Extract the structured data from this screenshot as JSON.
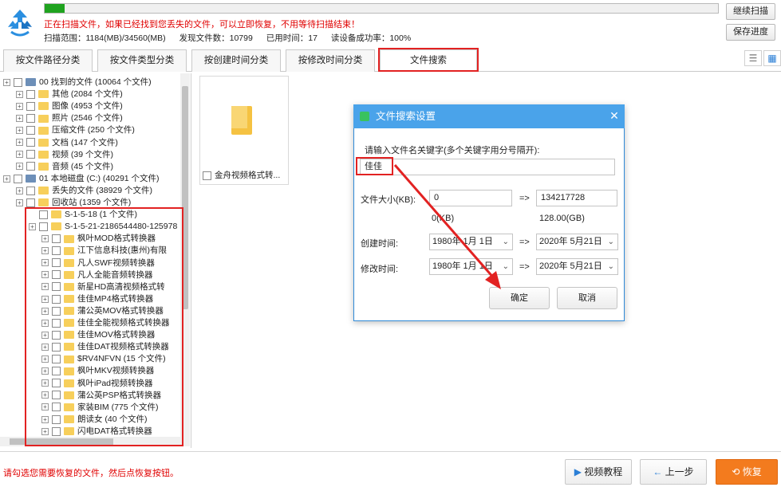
{
  "header": {
    "progress_fraction": 0.03,
    "status_text": "正在扫描文件，如果已经找到您丢失的文件，可以立即恢复，不用等待扫描结束！",
    "scan_range": "扫描范围：1184(MB)/34560(MB)",
    "found_files": "发现文件数：10799",
    "elapsed": "已用时间：17",
    "read_rate": "读设备成功率：100%",
    "continue_button": "继续扫描",
    "save_button": "保存进度"
  },
  "tabs": [
    {
      "label": "按文件路径分类"
    },
    {
      "label": "按文件类型分类"
    },
    {
      "label": "按创建时间分类"
    },
    {
      "label": "按修改时间分类"
    },
    {
      "label": "文件搜索"
    }
  ],
  "view_icons": [
    "list-view-icon",
    "grid-view-icon"
  ],
  "tree": {
    "rows": [
      {
        "text": "00 找到的文件   (10064 个文件)"
      },
      {
        "text": "其他     (2084 个文件)"
      },
      {
        "text": "图像     (4953 个文件)"
      },
      {
        "text": "照片     (2546 个文件)"
      },
      {
        "text": "压缩文件   (250 个文件)"
      },
      {
        "text": "文档     (147 个文件)"
      },
      {
        "text": "视频     (39 个文件)"
      },
      {
        "text": "音频     (45 个文件)"
      },
      {
        "text": "01 本地磁盘 (C:)  (40291 个文件)"
      },
      {
        "text": "丢失的文件   (38929 个文件)"
      },
      {
        "text": "回收站    (1359 个文件)"
      },
      {
        "text": "S-1-5-18     (1 个文件)"
      },
      {
        "text": "S-1-5-21-2186544480-125978"
      },
      {
        "text": "枫叶MOD格式转换器"
      },
      {
        "text": "江下信息科技(惠州)有限"
      },
      {
        "text": "凡人SWF视频转换器"
      },
      {
        "text": "凡人全能音频转换器"
      },
      {
        "text": "新星HD高清视频格式转"
      },
      {
        "text": "佳佳MP4格式转换器"
      },
      {
        "text": "蒲公英MOV格式转换器"
      },
      {
        "text": "佳佳全能视频格式转换器"
      },
      {
        "text": "佳佳MOV格式转换器"
      },
      {
        "text": "佳佳DAT视频格式转换器"
      },
      {
        "text": "$RV4NFVN     (15 个文件)"
      },
      {
        "text": "枫叶MKV视频转换器"
      },
      {
        "text": "枫叶iPad视频转换器"
      },
      {
        "text": "蒲公英PSP格式转换器"
      },
      {
        "text": "家装BIM     (775 个文件)"
      },
      {
        "text": "朗读女     (40 个文件)"
      },
      {
        "text": "闪电DAT格式转换器"
      }
    ]
  },
  "content": {
    "file_card_label": "金舟视频格式转..."
  },
  "dialog": {
    "title": "文件搜索设置",
    "keyword_label": "请输入文件名关键字(多个关键字用分号隔开):",
    "keyword_value": "佳佳",
    "size_label": "文件大小(KB):",
    "size_min": "0",
    "size_max": "134217728",
    "size_min_note": "0(KB)",
    "size_max_note": "128.00(GB)",
    "created_label": "创建时间:",
    "modified_label": "修改时间:",
    "created_from": "1980年  1月  1日",
    "created_to": "2020年  5月21日",
    "modified_from": "1980年  1月  1日",
    "modified_to": "2020年  5月21日",
    "range_arrow": "=>",
    "ok_button": "确定",
    "cancel_button": "取消"
  },
  "footer": {
    "message": "请勾选您需要恢复的文件，然后点恢复按钮。",
    "video_button": "视频教程",
    "back_button": "上一步",
    "recover_button": "恢复"
  },
  "colors": {
    "accent_blue": "#4aa3ea",
    "highlight_red": "#e22222",
    "recover_orange": "#f37b1e",
    "progress_green": "#1fa31f"
  }
}
